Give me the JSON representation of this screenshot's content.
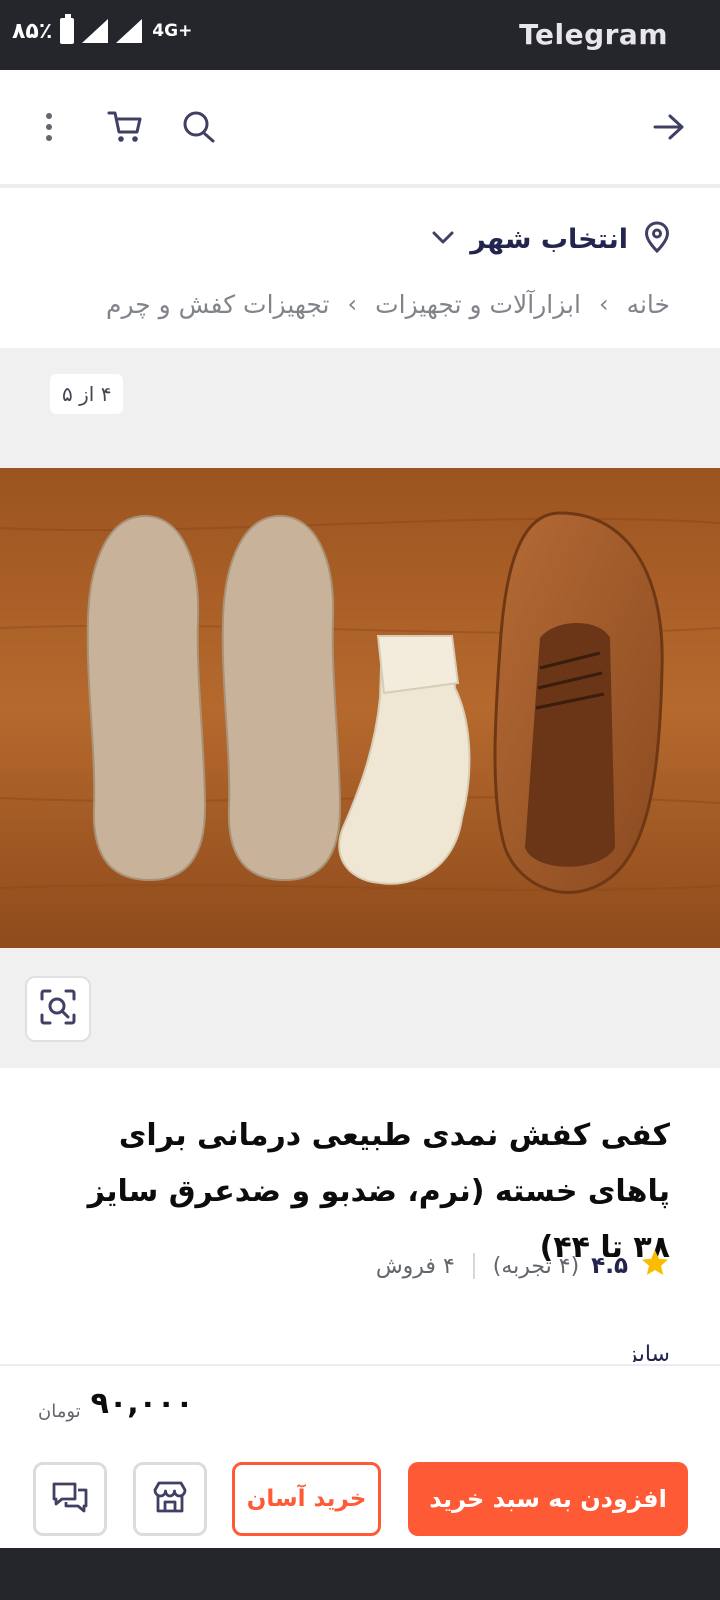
{
  "status_bar": {
    "battery_text": "۸۵٪",
    "network": "4G+",
    "app_name": "Telegram"
  },
  "header": {
    "icons": [
      "back-arrow-icon",
      "search-icon",
      "cart-icon",
      "more-vertical-icon"
    ]
  },
  "location": {
    "label": "انتخاب شهر"
  },
  "breadcrumb": {
    "items": [
      "خانه",
      "ابزارآلات و تجهیزات",
      "تجهیزات کفش و چرم"
    ],
    "separator": "›"
  },
  "gallery": {
    "counter": "۴ از ۵"
  },
  "product": {
    "title": "کفی کفش نمدی طبیعی درمانی برای پاهای خسته (نرم، ضدبو و ضدعرق سایز ۳۸ تا ۴۴)",
    "rating": "۴.۵",
    "reviews": "(۴ تجربه)",
    "sales": "۴ فروش",
    "size_label": "سایز"
  },
  "purchase": {
    "price": "۹۰,۰۰۰",
    "currency": "تومان",
    "add_to_cart": "افزودن به سبد خرید",
    "easy_buy": "خرید آسان"
  },
  "colors": {
    "accent": "#ff5a36",
    "star": "#f9bc00",
    "dark_bar": "#25262b"
  }
}
